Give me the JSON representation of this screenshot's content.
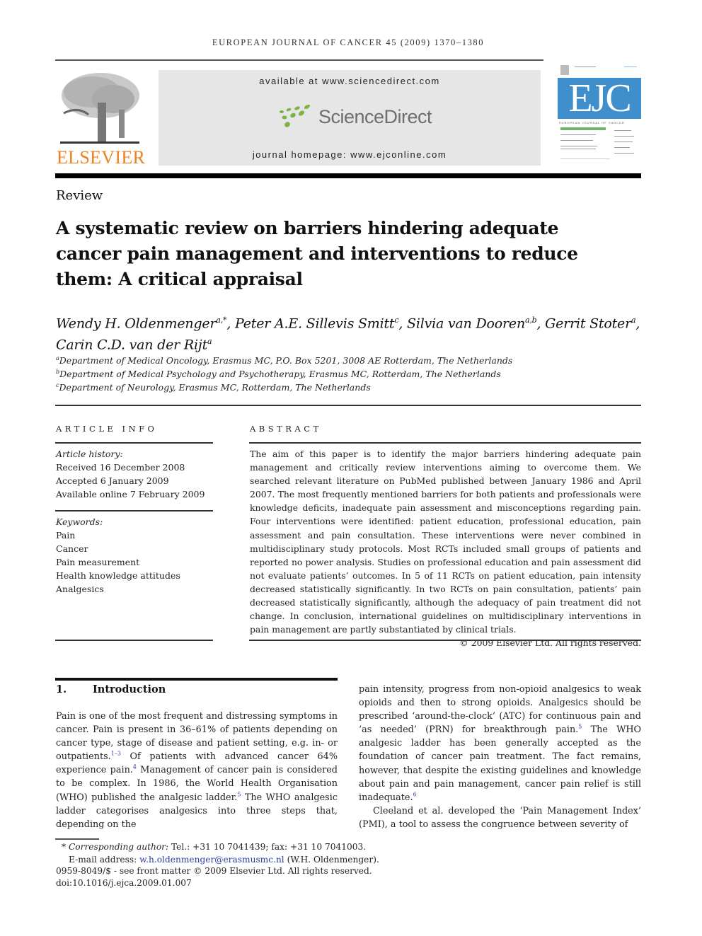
{
  "running_head": "EUROPEAN JOURNAL OF CANCER 45 (2009) 1370–1380",
  "header": {
    "publisher_logo_text": "ELSEVIER",
    "available_at": "available at www.sciencedirect.com",
    "sd_logo_text": "ScienceDirect",
    "journal_homepage": "journal homepage: www.ejconline.com",
    "cover_title": "EJC",
    "cover_subtitle": "EUROPEAN JOURNAL OF CANCER",
    "colors": {
      "elsevier_orange": "#f07f1e",
      "sd_green": "#7cb342",
      "ejc_blue": "#3e8fcb",
      "link_blue": "#2a3aa0"
    }
  },
  "article": {
    "type_label": "Review",
    "title_lines": [
      "A systematic review on barriers hindering adequate",
      "cancer pain management and interventions to reduce",
      "them: A critical appraisal"
    ],
    "authors": [
      {
        "name": "Wendy H. Oldenmenger",
        "sup": "a,*",
        "sep": ", "
      },
      {
        "name": "Peter A.E. Sillevis Smitt",
        "sup": "c",
        "sep": ", "
      },
      {
        "name": "Silvia van Dooren",
        "sup": "a,b",
        "sep": ", "
      },
      {
        "name": "Gerrit Stoter",
        "sup": "a",
        "sep": ","
      },
      {
        "name": "Carin C.D. van der Rijt",
        "sup": "a",
        "sep": ""
      }
    ],
    "affiliations": [
      {
        "sup": "a",
        "text": "Department of Medical Oncology, Erasmus MC, P.O. Box 5201, 3008 AE Rotterdam, The Netherlands"
      },
      {
        "sup": "b",
        "text": "Department of Medical Psychology and Psychotherapy, Erasmus MC, Rotterdam, The Netherlands"
      },
      {
        "sup": "c",
        "text": "Department of Neurology, Erasmus MC, Rotterdam, The Netherlands"
      }
    ]
  },
  "article_info": {
    "heading": "ARTICLE INFO",
    "history_label": "Article history:",
    "history": [
      "Received 16 December 2008",
      "Accepted 6 January 2009",
      "Available online 7 February 2009"
    ],
    "keywords_label": "Keywords:",
    "keywords": [
      "Pain",
      "Cancer",
      "Pain measurement",
      "Health knowledge attitudes",
      "Analgesics"
    ]
  },
  "abstract": {
    "heading": "ABSTRACT",
    "text": "The aim of this paper is to identify the major barriers hindering adequate pain management and critically review interventions aiming to overcome them. We searched relevant literature on PubMed published between January 1986 and April 2007. The most frequently mentioned barriers for both patients and professionals were knowledge deficits, inadequate pain assessment and misconceptions regarding pain. Four interventions were identified: patient education, professional education, pain assessment and pain consultation. These interventions were never combined in multidisciplinary study protocols. Most RCTs included small groups of patients and reported no power analysis. Studies on professional education and pain assessment did not evaluate patients’ outcomes. In 5 of 11 RCTs on patient education, pain intensity decreased statistically significantly. In two RCTs on pain consultation, patients’ pain decreased statistically significantly, although the adequacy of pain treatment did not change. In conclusion, international guidelines on multidisciplinary interventions in pain management are partly substantiated by clinical trials.",
    "copyright": "© 2009 Elsevier Ltd. All rights reserved."
  },
  "introduction": {
    "number": "1.",
    "heading": "Introduction",
    "left_col": [
      {
        "t": "Pain is one of the most frequent and distressing symptoms in cancer. Pain is present in 36–61% of patients depending on cancer type, stage of disease and patient setting, e.g. in- or outpatients."
      },
      {
        "ref": "1–3"
      },
      {
        "t": " Of patients with advanced cancer 64% experience pain."
      },
      {
        "ref": "4"
      },
      {
        "t": " Management of cancer pain is considered to be complex. In 1986, the World Health Organisation (WHO) published the analgesic ladder."
      },
      {
        "ref": "5"
      },
      {
        "t": " The WHO analgesic ladder categorises analgesics into three steps that, depending on the"
      }
    ],
    "right_col_p1": [
      {
        "t": "pain intensity, progress from non-opioid analgesics to weak opioids and then to strong opioids. Analgesics should be prescribed ‘around-the-clock’ (ATC) for continuous pain and ‘as needed’ (PRN) for breakthrough pain."
      },
      {
        "ref": "5"
      },
      {
        "t": " The WHO analgesic ladder has been generally accepted as the foundation of cancer pain treatment. The fact remains, however, that despite the existing guidelines and knowledge about pain and pain management, cancer pain relief is still inadequate."
      },
      {
        "ref": "6"
      }
    ],
    "right_col_p2": "Cleeland et al. developed the ‘Pain Management Index’ (PMI), a tool to assess the congruence between severity of"
  },
  "footnotes": {
    "star": "*",
    "corr_label": "Corresponding author:",
    "corr_text": " Tel.: +31 10 7041439; fax: +31 10 7041003.",
    "email_label": "E-mail address: ",
    "email": "w.h.oldenmenger@erasmusmc.nl",
    "email_suffix": " (W.H. Oldenmenger).",
    "issn_line": "0959-8049/$ - see front matter © 2009 Elsevier Ltd. All rights reserved.",
    "doi": "doi:10.1016/j.ejca.2009.01.007"
  }
}
